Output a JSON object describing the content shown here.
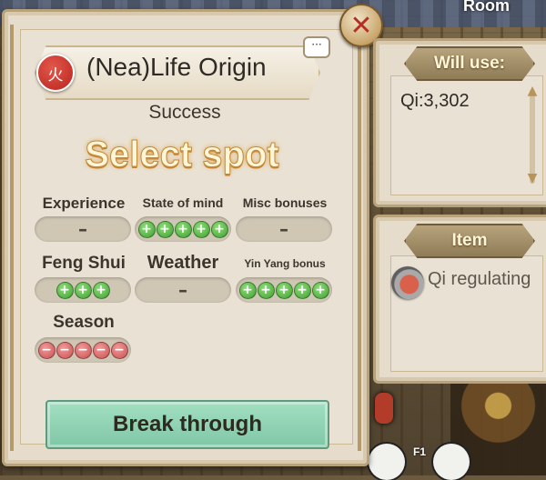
{
  "background": {
    "room_label": "Room",
    "hotkey_label": "F1"
  },
  "dialog": {
    "close_glyph": "✕",
    "title": {
      "element_glyph": "火",
      "name": "(Nea)Life Origin",
      "chat_glyph": "···"
    },
    "result": "Success",
    "instruction": "Select spot",
    "bonuses": [
      {
        "label": "Experience",
        "value": "–",
        "pips": []
      },
      {
        "label": "State of mind",
        "value": "",
        "pips": [
          "+",
          "+",
          "+",
          "+",
          "+"
        ]
      },
      {
        "label": "Misc bonuses",
        "value": "–",
        "pips": []
      },
      {
        "label": "Feng Shui",
        "value": "",
        "pips": [
          "+",
          "+",
          "+"
        ]
      },
      {
        "label": "Weather",
        "value": "–",
        "pips": []
      },
      {
        "label": "Yin Yang bonus",
        "value": "",
        "pips": [
          "+",
          "+",
          "+",
          "+",
          "+"
        ]
      },
      {
        "label": "Season",
        "value": "",
        "pips": [
          "−",
          "−",
          "−",
          "−",
          "−"
        ]
      }
    ],
    "action_button": "Break through"
  },
  "will_use": {
    "heading": "Will use:",
    "entries": [
      "Qi:3,302"
    ],
    "scroll_up": "▲",
    "scroll_down": "▼"
  },
  "item": {
    "heading": "Item",
    "name": "Qi regulating",
    "icon": "qi-regulating-pill-bowl-icon"
  },
  "colors": {
    "positive_pip": "#4caf3a",
    "negative_pip": "#d05c5c",
    "button_green": "#8fd3b3",
    "panel": "#e6dccb"
  }
}
